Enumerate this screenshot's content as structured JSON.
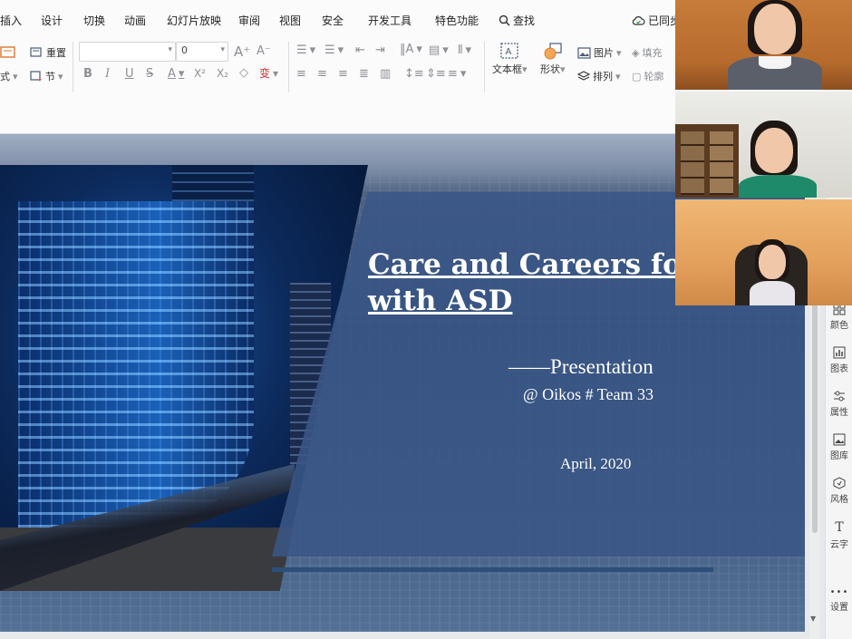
{
  "menu": {
    "tabs": [
      "插入",
      "设计",
      "切换",
      "动画",
      "幻灯片放映",
      "审阅",
      "视图",
      "安全",
      "开发工具",
      "特色功能"
    ],
    "search_label": "查找",
    "sync_label": "已同步"
  },
  "toolbar": {
    "reset_label": "重置",
    "section_label": "节",
    "layout_label": "式",
    "font_name": "",
    "font_size": "0",
    "text_box_label": "文本框",
    "shape_label": "形状",
    "picture_label": "图片",
    "fill_label": "填充",
    "arrange_label": "排列",
    "outline_label": "轮廓"
  },
  "slide": {
    "title_line1": "Care and Careers for P",
    "title_line2": "with ASD",
    "subtitle": "——Presentation",
    "team": "@ Oikos # Team 33",
    "date": "April, 2020"
  },
  "task_pane": {
    "items": [
      "颜色",
      "图表",
      "属性",
      "图库",
      "风格",
      "云字",
      "设置"
    ]
  },
  "colors": {
    "title_band": "#3a5686",
    "slide_bg": "#2b4266",
    "video1_bg": "#c87c3b",
    "video3_bg": "#f0b774"
  }
}
